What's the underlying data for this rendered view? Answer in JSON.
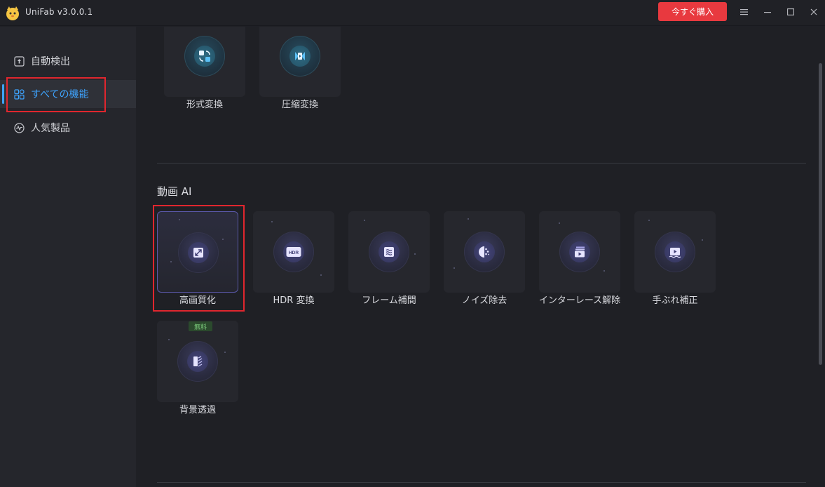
{
  "titlebar": {
    "title": "UniFab v3.0.0.1",
    "buy_label": "今すぐ購入",
    "menu_icon": "menu-icon",
    "minimize_icon": "minimize-icon",
    "maximize_icon": "maximize-icon",
    "close_icon": "close-icon"
  },
  "sidebar": {
    "items": [
      {
        "label": "自動検出",
        "icon": "detect-icon"
      },
      {
        "label": "すべての機能",
        "icon": "grid-icon",
        "active": true
      },
      {
        "label": "人気製品",
        "icon": "popular-icon"
      }
    ]
  },
  "top_cards": [
    {
      "label": "形式変換",
      "icon": "convert-icon"
    },
    {
      "label": "圧縮変換",
      "icon": "compress-icon"
    }
  ],
  "video_ai": {
    "title": "動画 AI",
    "cards": [
      {
        "label": "高画質化",
        "icon": "upscale-icon"
      },
      {
        "label": "HDR 変換",
        "icon": "hdr-icon",
        "icon_text": "HDR"
      },
      {
        "label": "フレーム補間",
        "icon": "frame-interpolation-icon"
      },
      {
        "label": "ノイズ除去",
        "icon": "denoise-icon"
      },
      {
        "label": "インターレース解除",
        "icon": "deinterlace-icon"
      },
      {
        "label": "手ぶれ補正",
        "icon": "stabilize-icon"
      },
      {
        "label": "背景透過",
        "icon": "background-removal-icon",
        "badge": "無料"
      }
    ]
  },
  "colors": {
    "accent": "#3ea4ff",
    "buy_button": "#e8393f",
    "highlight_box": "#e0262e",
    "free_badge_text": "#7fd07f"
  }
}
